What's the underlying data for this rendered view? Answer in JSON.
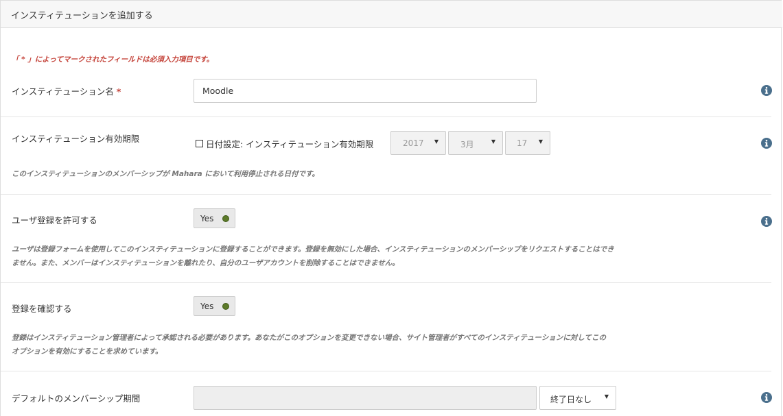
{
  "panel": {
    "title": "インスティテューションを追加する"
  },
  "required_note": "「 * 」によってマークされたフィールドは必須入力項目です。",
  "fields": {
    "name": {
      "label": "インスティテューション名",
      "required_mark": "*",
      "value": "Moodle"
    },
    "expiry": {
      "label": "インスティテューション有効期限",
      "checkbox_label": "日付設定: インスティテューション有効期限",
      "year": "2017",
      "month": "3月",
      "day": "17",
      "description": "このインスティテューションのメンバーシップが Mahara において利用停止される日付です。"
    },
    "registration": {
      "label": "ユーザ登録を許可する",
      "toggle": "Yes",
      "description_line1": "ユーザは登録フォームを使用してこのインスティテューションに登録することができます。登録を無効にした場合、インスティテューションのメンバーシップをリクエストすることはでき",
      "description_line2": "ません。また、メンバーはインスティテューションを離れたり、自分のユーザアカウントを削除することはできません。"
    },
    "confirm": {
      "label": "登録を確認する",
      "toggle": "Yes",
      "description_line1": "登録はインスティテューション管理者によって承認される必要があります。あなたがこのオプションを変更できない場合、サイト管理者がすべてのインスティテューションに対してこの",
      "description_line2": "オプションを有効にすることを求めています。"
    },
    "membership_period": {
      "label": "デフォルトのメンバーシップ期間",
      "select": "終了日なし"
    }
  },
  "colors": {
    "required": "#c5453c",
    "toggle_on": "#5c7a29",
    "info": "#4a6f8c"
  },
  "icons": {
    "info": "info-circle-icon",
    "dropdown": "caret-down-icon"
  }
}
